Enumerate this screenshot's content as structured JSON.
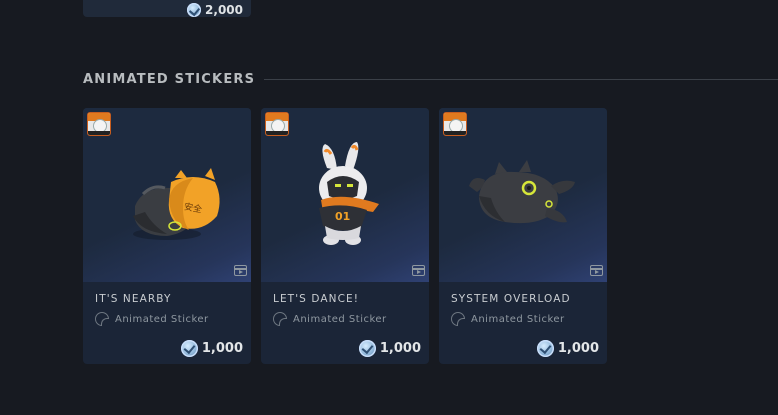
{
  "previous_item": {
    "price": "2,000"
  },
  "section": {
    "title": "ANIMATED STICKERS"
  },
  "items": [
    {
      "title": "IT'S NEARBY",
      "type": "Animated Sticker",
      "price": "1,000",
      "art": "hardhat-sticker"
    },
    {
      "title": "LET'S DANCE!",
      "type": "Animated Sticker",
      "price": "1,000",
      "art": "bunny-sticker"
    },
    {
      "title": "SYSTEM OVERLOAD",
      "type": "Animated Sticker",
      "price": "1,000",
      "art": "creature-sticker"
    }
  ],
  "colors": {
    "background": "#171a21",
    "card": "#1b2537",
    "accent_orange": "#f2a227",
    "accent_yellow": "#d6e63a"
  }
}
